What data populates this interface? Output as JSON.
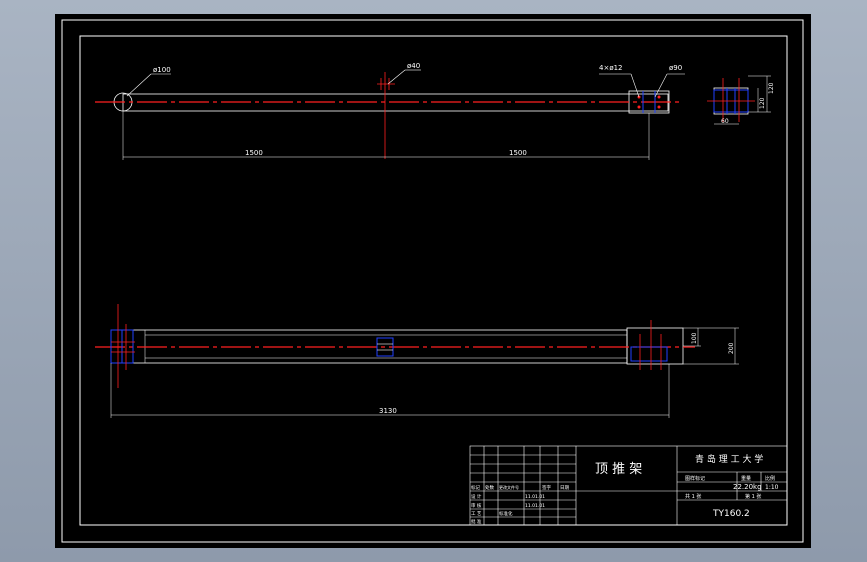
{
  "colors": {
    "background": "#000000",
    "outline": "#ffffff",
    "centerline": "#ff2020",
    "hidden": "#2040ff"
  },
  "top_view": {
    "dia_end": "ø100",
    "dia_mid": "ø40",
    "holes": "4×ø12",
    "dia_right": "ø90",
    "dim_left": "1500",
    "dim_right": "1500"
  },
  "side_view": {
    "dim_v1": "120",
    "dim_v2": "120",
    "dim_h": "60"
  },
  "front_view": {
    "dim_total": "3130",
    "dim_h1": "100",
    "dim_h2": "200"
  },
  "title_block": {
    "part_name": "顶  推  架",
    "school": "青 岛 理 工 大 学",
    "mass": "22.20kg",
    "scale": "1:10",
    "drawing_no": "TY160.2",
    "sheet_left": "共  1  张",
    "sheet_right": "第  1  张",
    "h_mark": "标记",
    "h_count": "处数",
    "h_change": "更改文件号",
    "h_sign": "签字",
    "h_date": "日期",
    "r_design": "设 计",
    "r_check": "审 核",
    "r_craft": "工 艺",
    "r_std": "标准化",
    "r_approve": "批 准",
    "c_stage": "图样标记",
    "c_weight": "重量",
    "c_scale": "比例",
    "designer_date": "11.01.01",
    "checker_date": "11.01.01"
  }
}
